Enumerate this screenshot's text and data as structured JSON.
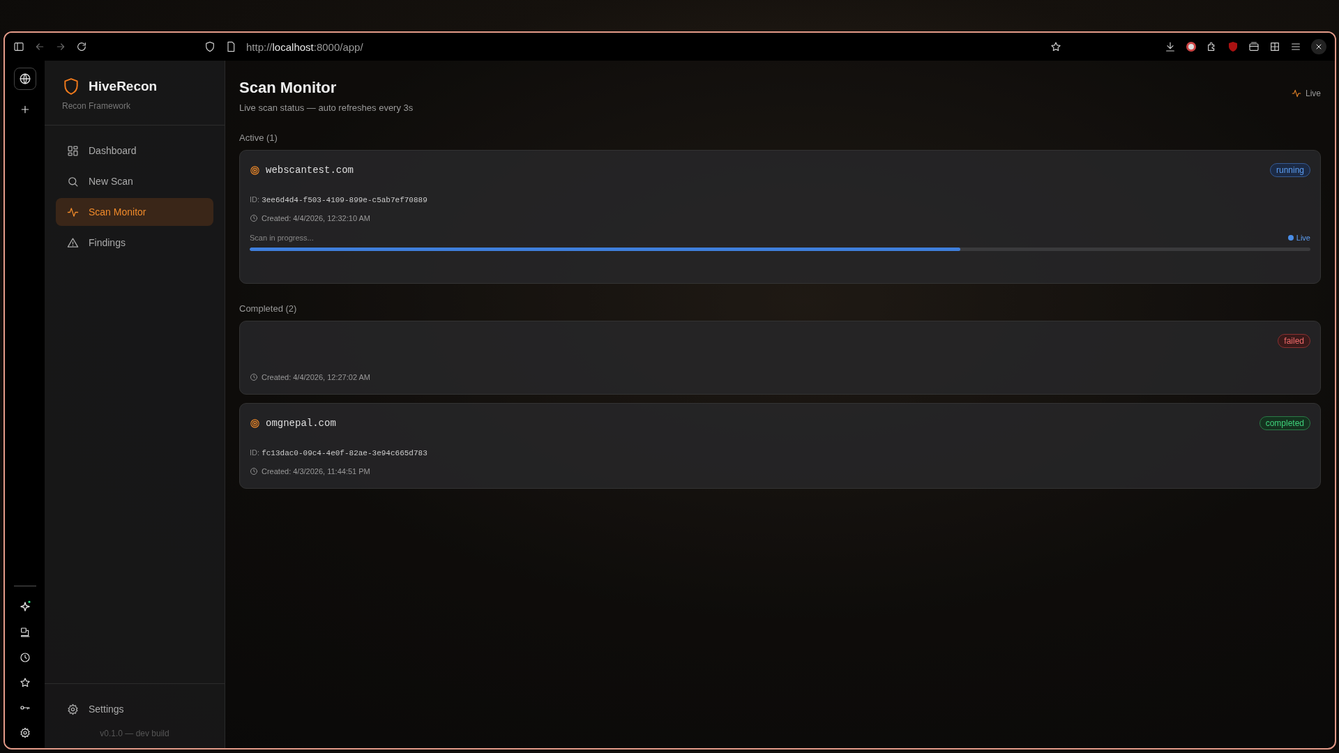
{
  "browser": {
    "back_disabled": true,
    "forward_disabled": true,
    "url_scheme": "http://",
    "url_host": "localhost",
    "url_rest": ":8000/app/"
  },
  "sidebar": {
    "brand": "HiveRecon",
    "tagline": "Recon Framework",
    "items": [
      {
        "kind": "grid",
        "label": "Dashboard",
        "selected": false
      },
      {
        "kind": "search",
        "label": "New Scan",
        "selected": false
      },
      {
        "kind": "pulse",
        "label": "Scan Monitor",
        "selected": true
      },
      {
        "kind": "warning",
        "label": "Findings",
        "selected": false
      }
    ],
    "settings": "Settings",
    "version": "v0.1.0 — dev build"
  },
  "header": {
    "title": "Scan Monitor",
    "subtitle": "Live scan status — auto refreshes every 3s",
    "live": "Live"
  },
  "sections": [
    {
      "heading": "Active (1)",
      "scans": [
        {
          "target": "webscantest.com",
          "id_label": "ID:",
          "id": "3ee6d4d4-f503-4109-899e-c5ab7ef70889",
          "created": "Created: 4/4/2026, 12:32:10 AM",
          "status": "running",
          "progress": {
            "label": "Scan in progress...",
            "live": "Live",
            "level": 0.67
          }
        }
      ]
    },
    {
      "heading": "Completed (2)",
      "scans": [
        {
          "created": "Created: 4/4/2026, 12:27:02 AM",
          "status": "failed"
        },
        {
          "target": "omgnepal.com",
          "id_label": "ID:",
          "id": "fc13dac0-09c4-4e0f-82ae-3e94c665d783",
          "created": "Created: 4/3/2026, 11:44:51 PM",
          "status": "completed"
        }
      ]
    }
  ]
}
